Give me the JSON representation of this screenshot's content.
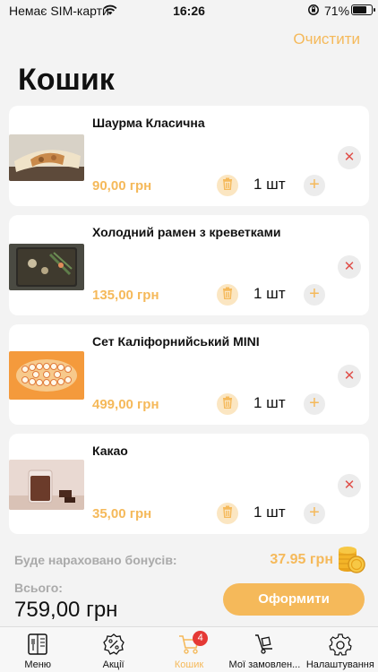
{
  "status_bar": {
    "carrier": "Немає SIM-карти",
    "time": "16:26",
    "battery": "71%"
  },
  "header": {
    "clear_label": "Очистити",
    "title": "Кошик"
  },
  "cart": {
    "items": [
      {
        "name": "Шаурма Класична",
        "price": "90,00 грн",
        "qty": "1 шт"
      },
      {
        "name": "Холодний рамен з креветками",
        "price": "135,00 грн",
        "qty": "1 шт"
      },
      {
        "name": "Сет Каліфорнийський MINI",
        "price": "499,00 грн",
        "qty": "1 шт"
      },
      {
        "name": "Какао",
        "price": "35,00 грн",
        "qty": "1 шт"
      }
    ]
  },
  "summary": {
    "bonus_label": "Буде нараховано бонусів:",
    "bonus_value": "37.95 грн",
    "total_label": "Всього:",
    "total_value": "759,00 грн",
    "checkout_label": "Оформити"
  },
  "tabs": [
    {
      "label": "Меню",
      "icon": "menu-book-icon"
    },
    {
      "label": "Акції",
      "icon": "discount-icon"
    },
    {
      "label": "Кошик",
      "icon": "cart-icon",
      "badge": "4",
      "active": true
    },
    {
      "label": "Мої замовлен...",
      "icon": "orders-icon"
    },
    {
      "label": "Налаштування",
      "icon": "gear-icon"
    }
  ],
  "colors": {
    "accent": "#f5b95a",
    "remove": "#e0504a",
    "badge": "#e53935"
  }
}
